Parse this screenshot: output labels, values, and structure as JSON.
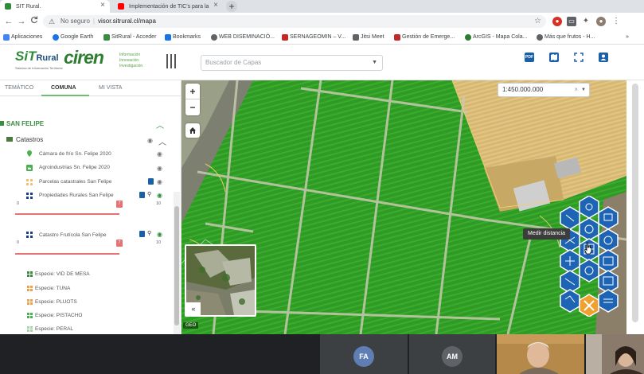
{
  "browser": {
    "tabs": [
      {
        "title": "SIT Rural."
      },
      {
        "title": "Implementación de TIC's para la"
      }
    ],
    "new_tab": "+",
    "nav": {
      "back": "←",
      "forward": "→",
      "reload": "C",
      "home": "⌂"
    },
    "security_label": "No seguro",
    "url": "visor.sitrural.cl/mapa",
    "bookmarks": [
      "Aplicaciones",
      "Google Earth",
      "SitRural - Acceder",
      "Bookmarks",
      "WEB DISEMINACIÓ...",
      "SERNAGEOMIN – V...",
      "Jitsi Meet",
      "Gestión de Emerge...",
      "ArcGIS - Mapa Cola...",
      "Más que frutos - H..."
    ],
    "bookmarks_more": "»"
  },
  "header": {
    "logo_sit": "SiT",
    "logo_sit_r": "Rural",
    "logo_sit_sub": "Sistema de Información Territorial",
    "logo_ciren": "ciren",
    "tagline": [
      "Información",
      "Innovación",
      "Investigación"
    ],
    "layer_search_placeholder": "Buscador de Capas",
    "icons": [
      "pdf-icon",
      "map-icon",
      "fullscreen-icon",
      "user-icon"
    ],
    "pdf_label": "PDF"
  },
  "sidebar": {
    "tabs": [
      "TEMÁTICO",
      "COMUNA",
      "MI VISTA"
    ],
    "municipality": "SAN FELIPE",
    "group": "Catastros",
    "layers": [
      {
        "name": "Cámara de frío Sn. Felipe 2020"
      },
      {
        "name": "Agroindustrias Sn. Felipe 2020"
      },
      {
        "name": "Parcelas catastrales San Felipe"
      },
      {
        "name": "Propiedades Rurales San Felipe",
        "min": "0",
        "max": "10",
        "value": "7"
      },
      {
        "name": "Catastro Frutícola San Felipe",
        "min": "0",
        "max": "10",
        "value": "7"
      }
    ],
    "species": [
      "Especie: VID DE MESA",
      "Especie: TUNA",
      "Especie: PLUOTS",
      "Especie: PISTACHO",
      "Especie: PERAL"
    ]
  },
  "map": {
    "zoom_in": "+",
    "zoom_out": "−",
    "scale": "1:450.000.000",
    "scale_clear": "×",
    "tooltip": "Medir distancia",
    "minimap_collapse": "«",
    "geo_label": "GEO"
  },
  "call": {
    "participants": [
      {
        "initials": "FA",
        "color": "#5f7fb4"
      },
      {
        "initials": "AM",
        "color": "#5f6368"
      }
    ]
  },
  "colors": {
    "field_green": "#3a9a2a",
    "accent_blue": "#1a5fa8",
    "brand_green": "#2e8b3a"
  }
}
